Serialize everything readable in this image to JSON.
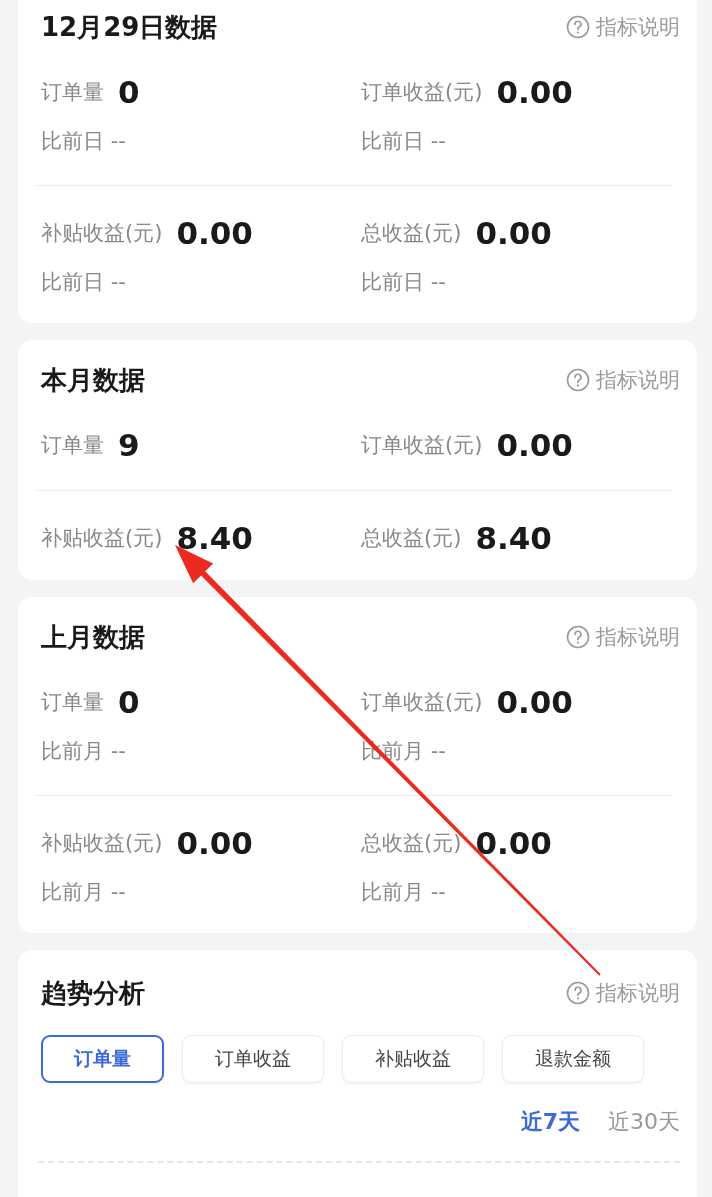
{
  "cards": [
    {
      "title": "12月29日数据",
      "help": "指标说明",
      "groups": [
        [
          {
            "label": "订单量",
            "value": "0",
            "compare": "比前日 --"
          },
          {
            "label": "订单收益(元)",
            "value": "0.00",
            "compare": "比前日 --"
          }
        ],
        [
          {
            "label": "补贴收益(元)",
            "value": "0.00",
            "compare": "比前日 --"
          },
          {
            "label": "总收益(元)",
            "value": "0.00",
            "compare": "比前日 --"
          }
        ]
      ]
    },
    {
      "title": "本月数据",
      "help": "指标说明",
      "groups": [
        [
          {
            "label": "订单量",
            "value": "9"
          },
          {
            "label": "订单收益(元)",
            "value": "0.00"
          }
        ],
        [
          {
            "label": "补贴收益(元)",
            "value": "8.40"
          },
          {
            "label": "总收益(元)",
            "value": "8.40"
          }
        ]
      ]
    },
    {
      "title": "上月数据",
      "help": "指标说明",
      "groups": [
        [
          {
            "label": "订单量",
            "value": "0",
            "compare": "比前月 --"
          },
          {
            "label": "订单收益(元)",
            "value": "0.00",
            "compare": "比前月 --"
          }
        ],
        [
          {
            "label": "补贴收益(元)",
            "value": "0.00",
            "compare": "比前月 --"
          },
          {
            "label": "总收益(元)",
            "value": "0.00",
            "compare": "比前月 --"
          }
        ]
      ]
    }
  ],
  "trend": {
    "title": "趋势分析",
    "help": "指标说明",
    "tabs": [
      {
        "label": "订单量",
        "selected": true
      },
      {
        "label": "订单收益",
        "selected": false
      },
      {
        "label": "补贴收益",
        "selected": false
      },
      {
        "label": "退款金额",
        "selected": false
      }
    ],
    "ranges": [
      {
        "label": "近7天",
        "selected": true
      },
      {
        "label": "近30天",
        "selected": false
      }
    ]
  }
}
